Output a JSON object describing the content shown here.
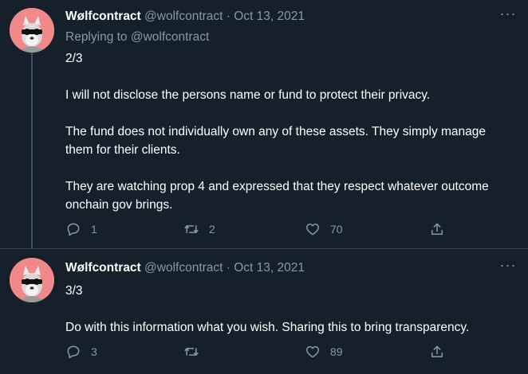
{
  "tweets": [
    {
      "display_name": "Wølfcontract",
      "handle": "@wolfcontract",
      "separator": " · ",
      "date": "Oct 13, 2021",
      "replying_to": "Replying to @wolfcontract",
      "paragraphs": [
        "2/3",
        "I will not disclose the persons name or fund to protect their privacy.",
        "The fund does not individually own any of these assets. They simply manage them for their clients.",
        "They are watching prop 4 and expressed that they respect whatever outcome onchain gov brings."
      ],
      "replies": "1",
      "retweets": "2",
      "likes": "70"
    },
    {
      "display_name": "Wølfcontract",
      "handle": "@wolfcontract",
      "separator": " · ",
      "date": "Oct 13, 2021",
      "paragraphs": [
        "3/3",
        "Do with this information what you wish. Sharing this to bring transparency."
      ],
      "replies": "3",
      "retweets": "",
      "likes": "89"
    }
  ],
  "more_icon": "···",
  "colors": {
    "background": "#15202b",
    "text": "#ffffff",
    "secondary": "#8899a6",
    "divider": "#38444d",
    "avatar_bg": "#f08a8a"
  },
  "icons": [
    "reply-icon",
    "retweet-icon",
    "like-icon",
    "share-icon",
    "more-icon"
  ]
}
